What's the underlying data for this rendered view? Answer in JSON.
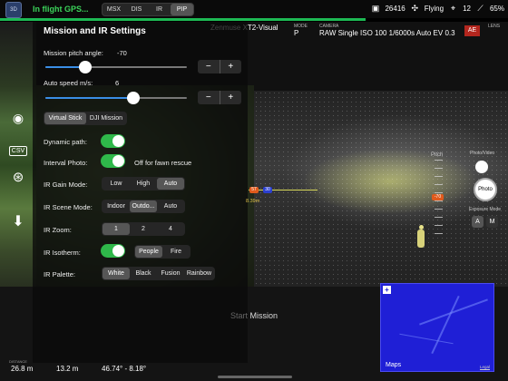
{
  "topbar": {
    "app_icon_text": "3D",
    "flight_status": "In flight GPS...",
    "camera_modes": [
      "MSX",
      "DIS",
      "IR",
      "PIP"
    ],
    "selected_camera_mode": "PIP",
    "photos_remaining": "26416",
    "flight_mode": "Flying",
    "satellites": "12",
    "battery": "65%",
    "progress_fraction": 0.72,
    "progress_color": "#1db954"
  },
  "camera_info": {
    "model_value": "Zenmuse XT2-Visual",
    "mode_label": "MODE",
    "mode_value": "P",
    "camera_label": "CAMERA",
    "camera_value": "RAW Single ISO 100 1/6000s Auto EV 0.3",
    "ae_label": "AE",
    "lens_label": "LENS"
  },
  "panel": {
    "title": "Mission and IR Settings",
    "pitch": {
      "label": "Mission pitch angle:",
      "value": "-70",
      "fraction": 0.28
    },
    "speed": {
      "label": "Auto speed m/s:",
      "value": "6",
      "fraction": 0.62
    },
    "stepper_minus": "−",
    "stepper_plus": "+",
    "mission_modes": [
      "Virtual Stick",
      "DJI Mission"
    ],
    "dynamic_path": {
      "label": "Dynamic path:",
      "on": true
    },
    "interval_photo": {
      "label": "Interval Photo:",
      "on": true,
      "note": "Off for fawn rescue"
    },
    "ir_gain": {
      "label": "IR Gain Mode:",
      "options": [
        "Low",
        "High",
        "Auto"
      ],
      "selected": "Auto"
    },
    "ir_scene": {
      "label": "IR Scene Mode:",
      "options": [
        "Indoor",
        "Outdo...",
        "Auto"
      ],
      "selected": "Outdo..."
    },
    "ir_zoom": {
      "label": "IR Zoom:",
      "options": [
        "1",
        "2",
        "4"
      ],
      "selected": "1"
    },
    "ir_isotherm": {
      "label": "IR Isotherm:",
      "on": true,
      "options": [
        "People",
        "Fire"
      ],
      "selected": "People"
    },
    "ir_palette": {
      "label": "IR Palette:",
      "options": [
        "White",
        "Black",
        "Fusion",
        "Rainbow"
      ],
      "selected": "White"
    }
  },
  "tools": {
    "csv_label": "CSV"
  },
  "hud": {
    "pitch_label": "Pitch",
    "pitch_value": "-70",
    "horizon_left": "57",
    "horizon_mid": "30",
    "distance": "8.39m",
    "photo_video_label": "Photo/Video",
    "photo_button": "Photo",
    "exposure_label": "Exposure Mode",
    "exposure_options": [
      "A",
      "M"
    ],
    "exposure_selected": "A"
  },
  "start_mission": {
    "prefix": "Start",
    "rest": " Mission"
  },
  "map": {
    "expand": "+",
    "logo": "Maps",
    "legal": "Legal"
  },
  "telemetry": {
    "distance_label": "DISTANCE",
    "distance": "26.8 m",
    "altitude": "13.2 m",
    "coordinates": "46.74° - 8.18°"
  }
}
